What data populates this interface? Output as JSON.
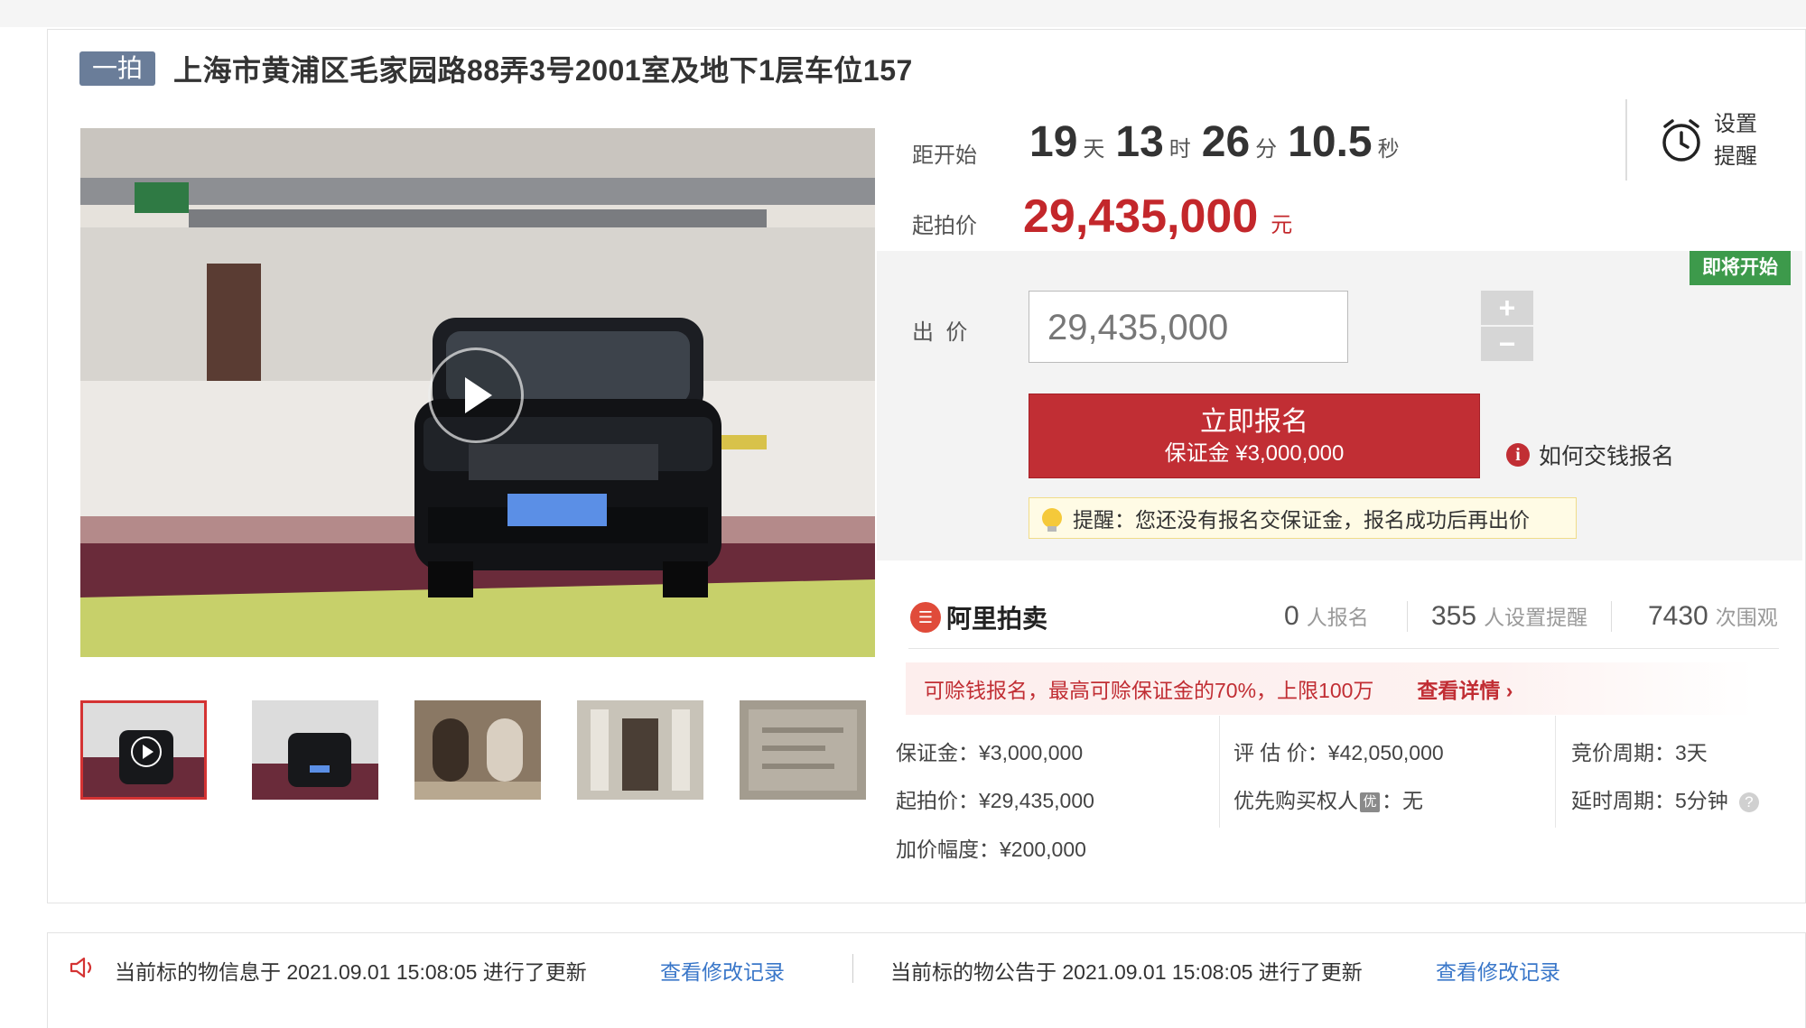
{
  "header": {
    "tag": "一拍",
    "title": "上海市黄浦区毛家园路88弄3号2001室及地下1层车位157"
  },
  "countdown": {
    "label": "距开始",
    "days": "19",
    "days_unit": "天",
    "hours": "13",
    "hours_unit": "时",
    "minutes": "26",
    "minutes_unit": "分",
    "seconds": "10.5",
    "seconds_unit": "秒"
  },
  "start_price": {
    "label": "起拍价",
    "value": "29,435,000",
    "unit": "元"
  },
  "reminder": {
    "label_line1": "设置",
    "label_line2": "提醒",
    "icon": "alarm-clock-icon"
  },
  "bid": {
    "badge": "即将开始",
    "label": "出  价",
    "input_value": "29,435,000",
    "plus": "+",
    "minus": "−",
    "signup_title": "立即报名",
    "signup_deposit": "保证金 ¥3,000,000",
    "howto_label": "如何交钱报名",
    "tip": "提醒：您还没有报名交保证金，报名成功后再出价"
  },
  "stats": {
    "brand": "阿里拍卖",
    "signups_num": "0",
    "signups_unit": "人报名",
    "reminders_num": "355",
    "reminders_unit": "人设置提醒",
    "views_num": "7430",
    "views_unit": "次围观"
  },
  "promo": {
    "text": "可赊钱报名，最高可赊保证金的70%，上限100万",
    "link": "查看详情 ›"
  },
  "details": {
    "deposit": "保证金：¥3,000,000",
    "start_price": "起拍价：¥29,435,000",
    "increment": "加价幅度：¥200,000",
    "appraisal": "评 估 价：¥42,050,000",
    "priority_label": "优先购买权人",
    "priority_icon": "优",
    "priority_value": "：无",
    "bid_period": "竞价周期：3天",
    "delay_period": "延时周期：5分钟",
    "help_icon": "?"
  },
  "footer": {
    "info_update": "当前标的物信息于 2021.09.01 15:08:05 进行了更新",
    "info_link": "查看修改记录",
    "notice_update": "当前标的物公告于 2021.09.01 15:08:05 进行了更新",
    "notice_link": "查看修改记录"
  },
  "colors": {
    "accent_red": "#c12e34",
    "price_red": "#c3272b",
    "badge_green": "#3d9a4b",
    "link_blue": "#3a77c9",
    "tag_blue_gray": "#6a7d99"
  }
}
